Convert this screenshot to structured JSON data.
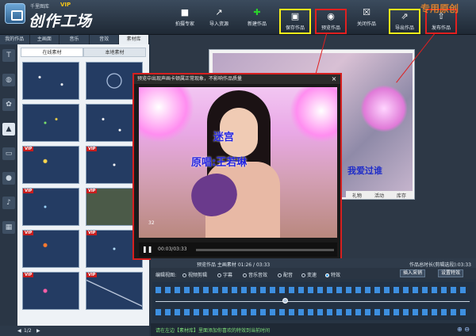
{
  "app": {
    "subtitle": "千里图库",
    "vip": "VIP",
    "title": "创作工场",
    "brand": "专用原创"
  },
  "toolbar": [
    {
      "name": "shoot-tool",
      "label": "拍摄专家",
      "icon": "camera-icon"
    },
    {
      "name": "import-tool",
      "label": "导入资源",
      "icon": "import-icon"
    },
    {
      "name": "new-tool",
      "label": "新建作品",
      "icon": "plus-icon"
    },
    {
      "name": "save-tool",
      "label": "保存作品",
      "icon": "save-icon"
    },
    {
      "name": "preview-tool",
      "label": "预览作品",
      "icon": "eye-icon"
    },
    {
      "name": "close-tool",
      "label": "关闭作品",
      "icon": "close-icon"
    },
    {
      "name": "export-tool",
      "label": "导出作品",
      "icon": "export-icon"
    },
    {
      "name": "publish-tool",
      "label": "发布作品",
      "icon": "upload-icon"
    }
  ],
  "left_tabs": [
    "我的作品",
    "主画面",
    "音乐",
    "音效",
    "素材库"
  ],
  "sub_tabs": [
    "在线素材",
    "本地素材"
  ],
  "thumbs": [
    {
      "vip": ""
    },
    {
      "vip": ""
    },
    {
      "vip": ""
    },
    {
      "vip": ""
    },
    {
      "vip": "VIP"
    },
    {
      "vip": "VIP"
    },
    {
      "vip": "VIP"
    },
    {
      "vip": "VIP"
    },
    {
      "vip": "VIP"
    },
    {
      "vip": "VIP"
    },
    {
      "vip": "VIP"
    },
    {
      "vip": "VIP"
    }
  ],
  "pager": {
    "text": "1/2"
  },
  "stage": {
    "bg_text": "我爱过谁",
    "bg_menu": [
      "礼物",
      "活动",
      "库存"
    ]
  },
  "preview": {
    "title": "预览中出现声画卡顿属正常现象，不影响作品质量",
    "close": "×",
    "song": "迷宫",
    "singer": "原唱:王若琳",
    "viewer_count": "32",
    "time": "00:03/03:33"
  },
  "timebar": {
    "left": "预览作品   主画素材   01:26 / 03:33",
    "right": "作品总时长(剪辑选段):03:33"
  },
  "editbar": {
    "label": "编辑视图:",
    "options": [
      "视频剪辑",
      "字幕",
      "音乐音效",
      "配音",
      "变速",
      "特效"
    ],
    "selected_index": 5,
    "insert_button": "插入采销",
    "settings_button": "设置特效"
  },
  "status": {
    "text": "请在左边【素材库】里面添加你喜欢的特效到当前时间"
  }
}
